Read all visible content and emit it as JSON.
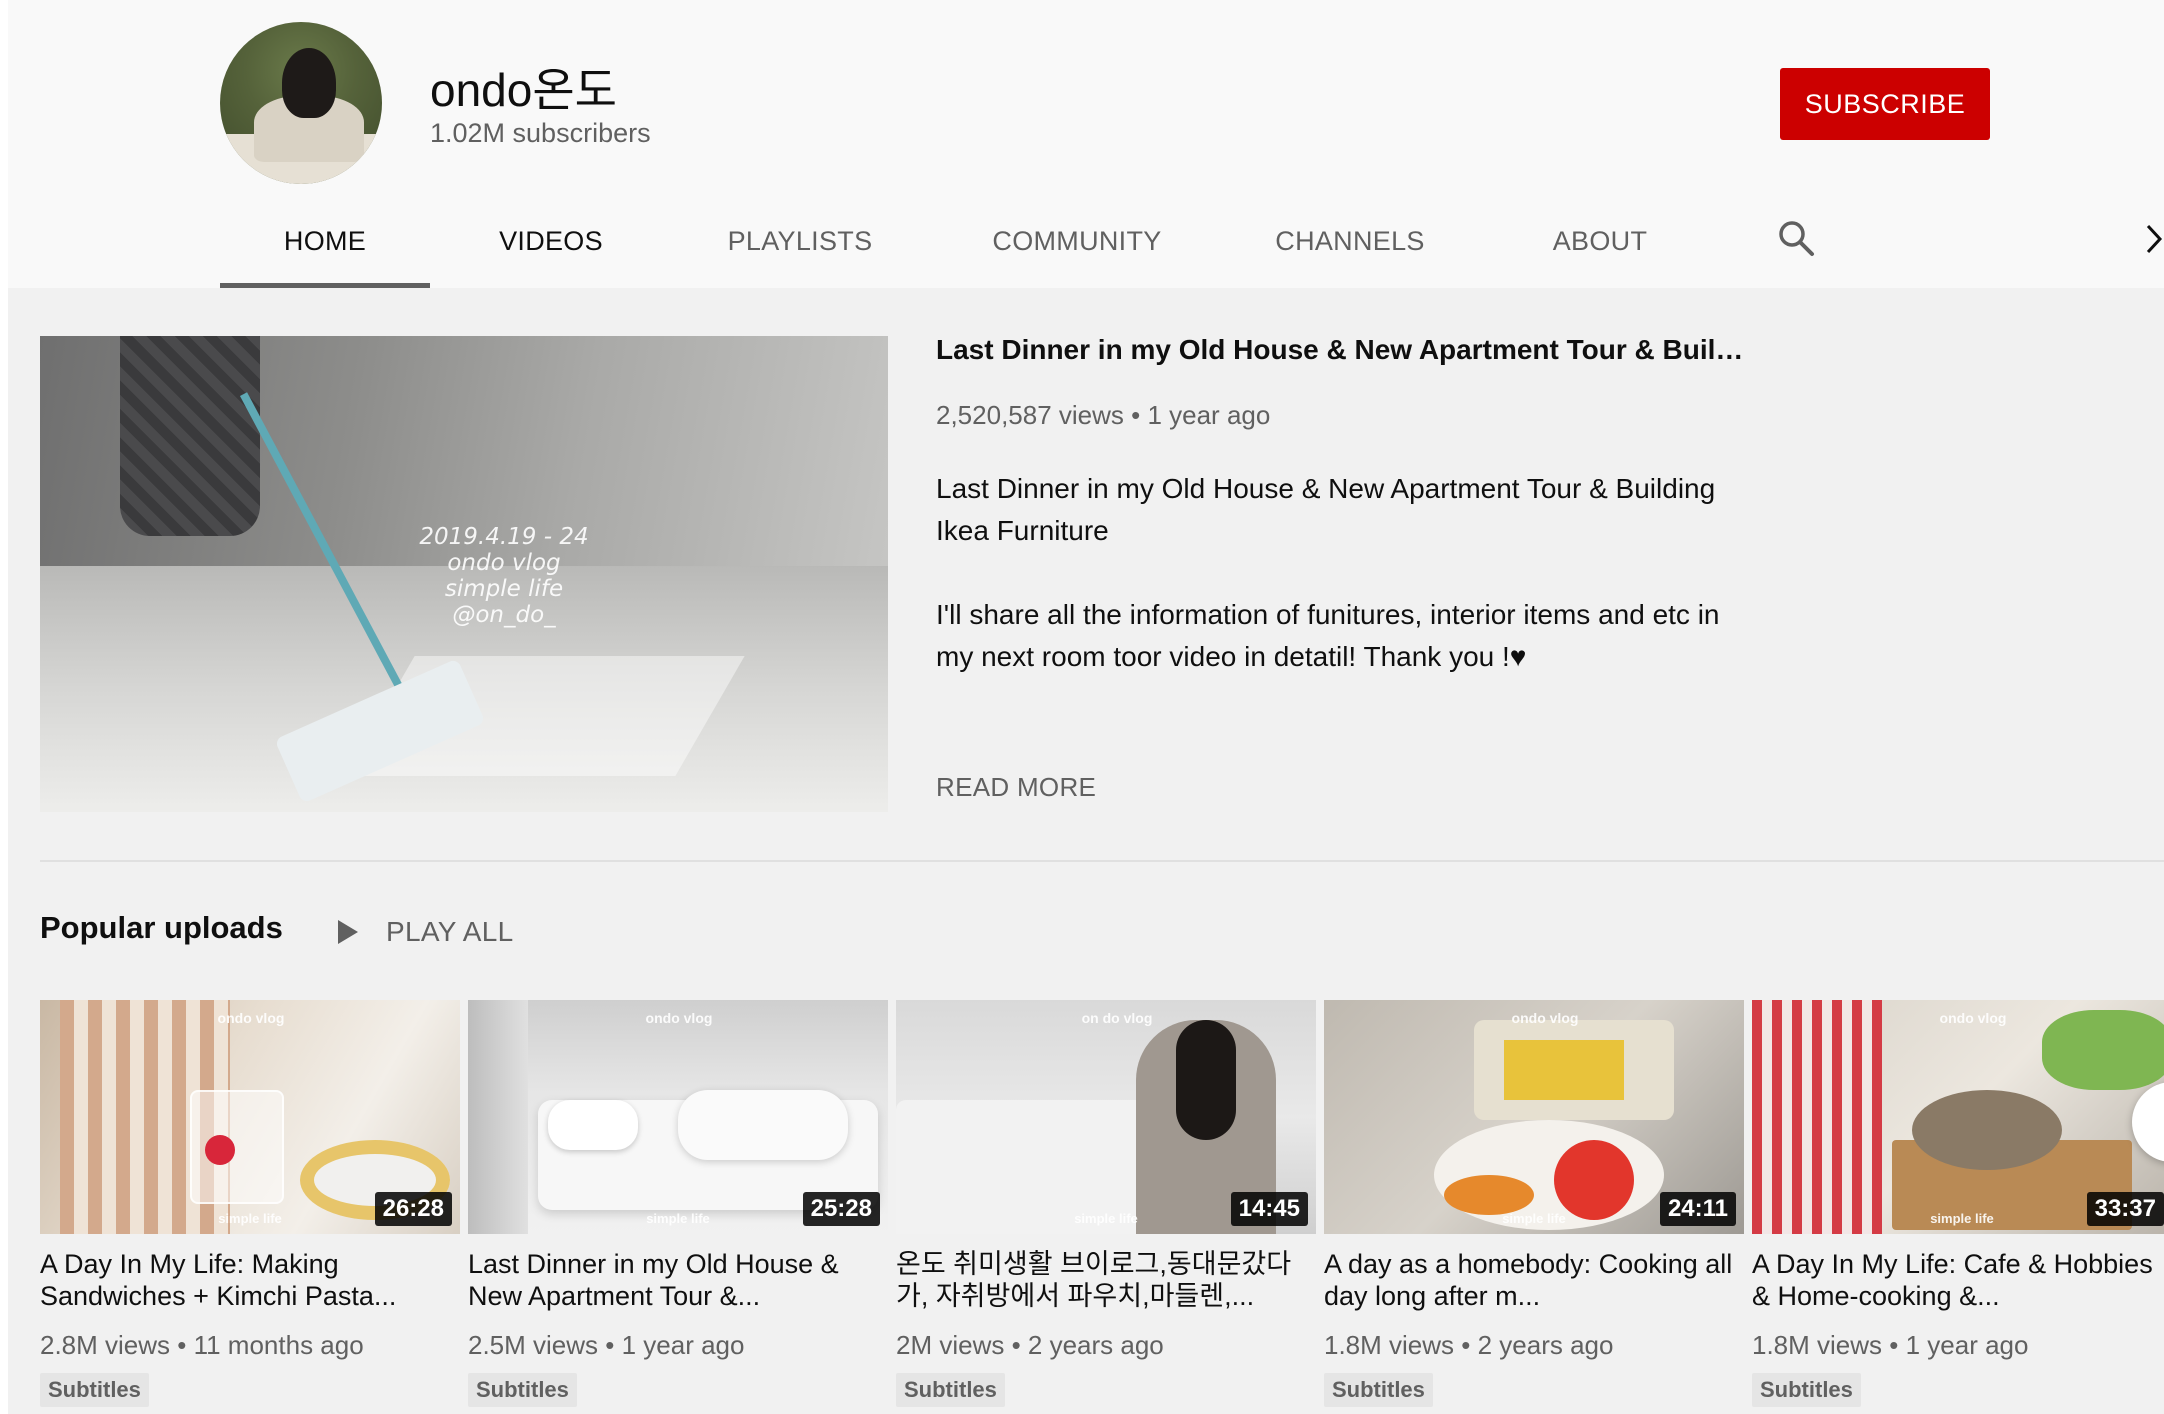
{
  "channel": {
    "name": "ondo온도",
    "subscribers": "1.02M subscribers",
    "subscribe_label": "SUBSCRIBE"
  },
  "tabs": [
    {
      "label": "HOME"
    },
    {
      "label": "VIDEOS"
    },
    {
      "label": "PLAYLISTS"
    },
    {
      "label": "COMMUNITY"
    },
    {
      "label": "CHANNELS"
    },
    {
      "label": "ABOUT"
    }
  ],
  "icons": {
    "search": "search-icon",
    "next": "chevron-right-icon",
    "play": "play-icon"
  },
  "colors": {
    "brand": "#cc0000",
    "background": "#f1f1f1",
    "header": "#f9f9f9",
    "secondary_text": "#606060"
  },
  "featured": {
    "thumb_text": [
      "2019.4.19 - 24",
      "ondo vlog",
      "simple life",
      "@on_do_"
    ],
    "title": "Last Dinner in my Old House & New Apartment Tour & Building...",
    "meta": "2,520,587 views • 1 year ago",
    "description_1": "Last Dinner in my Old House & New Apartment Tour & Building Ikea Furniture",
    "description_2": "I'll share all the information of funitures, interior items and etc in my next room toor video in detatil! Thank you  !♥",
    "read_more": "READ MORE"
  },
  "popular": {
    "title": "Popular uploads",
    "play_all": "PLAY ALL",
    "videos": [
      {
        "title": "A Day In My Life: Making Sandwiches + Kimchi Pasta...",
        "meta": "2.8M views • 11 months ago",
        "duration": "26:28",
        "badge": "Subtitles",
        "wm_top": "ondo vlog",
        "wm_bottom": "simple life"
      },
      {
        "title": "Last Dinner in my Old House & New Apartment Tour &...",
        "meta": "2.5M views • 1 year ago",
        "duration": "25:28",
        "badge": "Subtitles",
        "wm_top": "ondo vlog",
        "wm_bottom": "simple life"
      },
      {
        "title": "온도 취미생활 브이로그,동대문갔다가, 자취방에서 파우치,마들렌,...",
        "meta": "2M views • 2 years ago",
        "duration": "14:45",
        "badge": "Subtitles",
        "wm_top": "on do vlog",
        "wm_bottom": "simple life"
      },
      {
        "title": "A day as a homebody: Cooking all day long after m...",
        "meta": "1.8M views • 2 years ago",
        "duration": "24:11",
        "badge": "Subtitles",
        "wm_top": "ondo vlog",
        "wm_bottom": "simple life"
      },
      {
        "title": "A Day In My Life: Cafe & Hobbies & Home-cooking &...",
        "meta": "1.8M views • 1 year ago",
        "duration": "33:37",
        "badge": "Subtitles",
        "wm_top": "ondo vlog",
        "wm_bottom": "simple life"
      }
    ]
  }
}
